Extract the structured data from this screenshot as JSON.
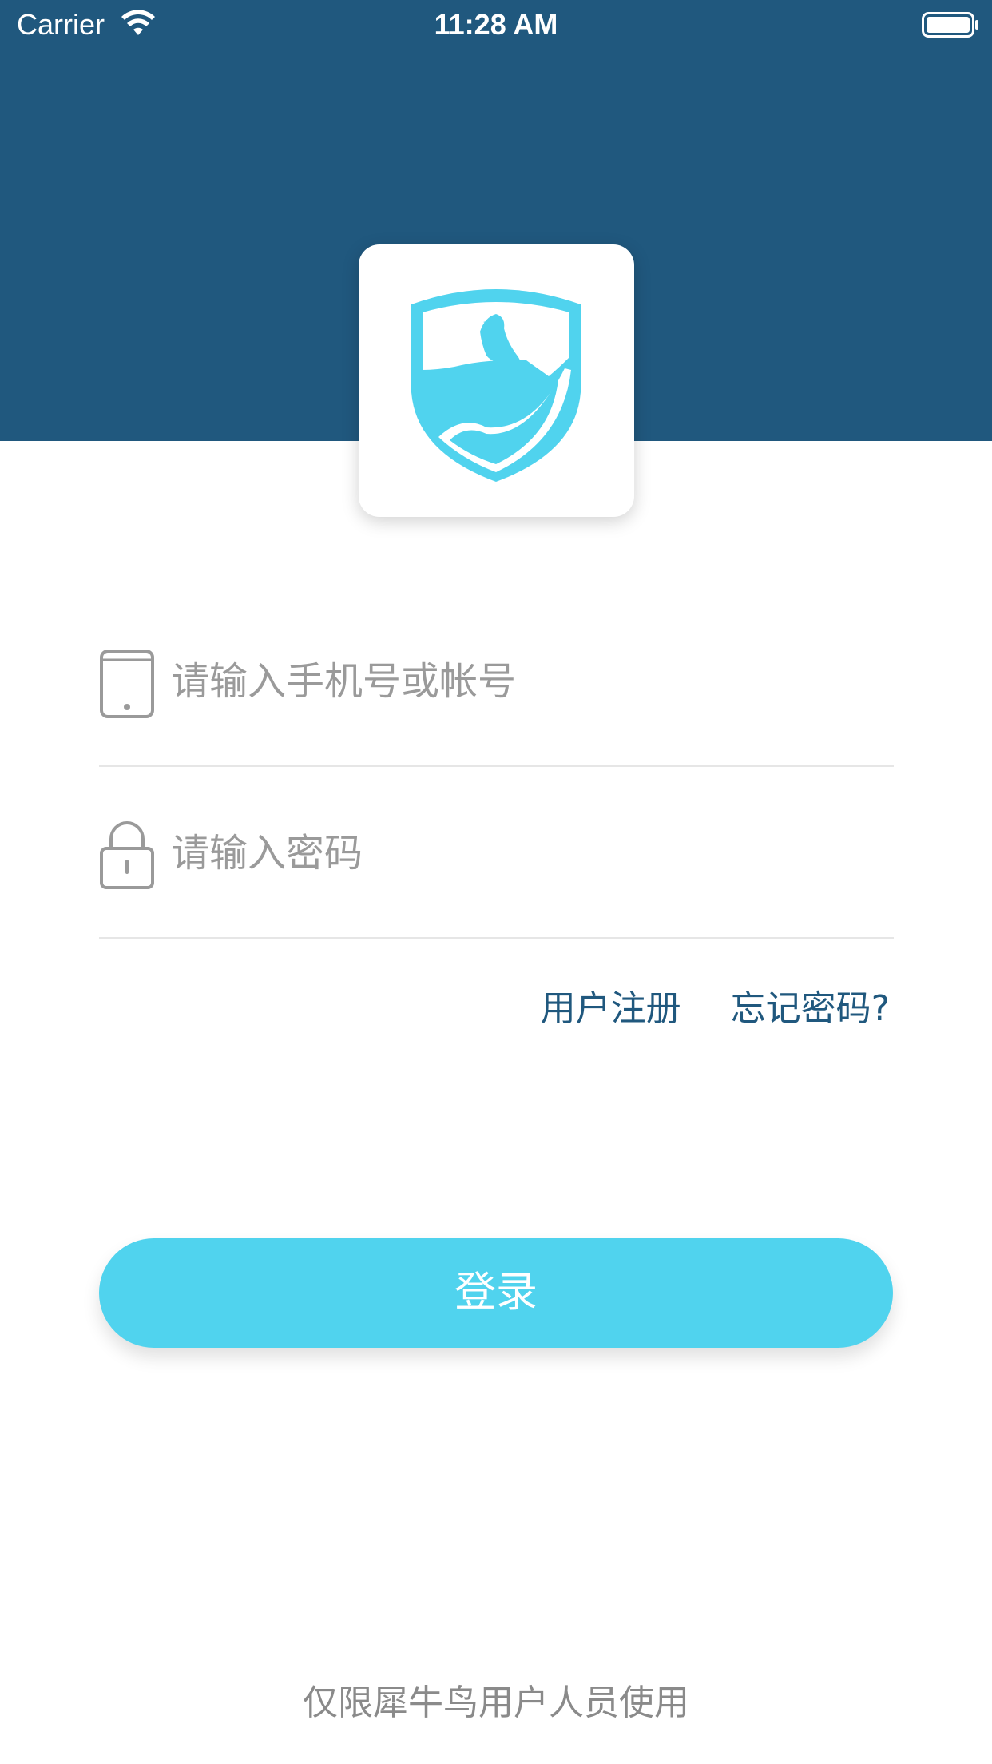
{
  "status_bar": {
    "carrier": "Carrier",
    "time": "11:28 AM",
    "wifi_icon": "wifi-icon",
    "battery_icon": "battery-icon"
  },
  "logo": {
    "icon": "shield-bird-logo-icon",
    "color": "#50d3ee"
  },
  "form": {
    "account": {
      "icon": "phone-icon",
      "placeholder": "请输入手机号或帐号",
      "value": ""
    },
    "password": {
      "icon": "lock-icon",
      "placeholder": "请输入密码",
      "value": ""
    }
  },
  "links": {
    "register_label": "用户注册",
    "forgot_label": "忘记密码?"
  },
  "login_button_label": "登录",
  "footer": "仅限犀牛鸟用户人员使用",
  "colors": {
    "header": "#20587e",
    "accent": "#50d3ee",
    "link": "#20587e"
  }
}
